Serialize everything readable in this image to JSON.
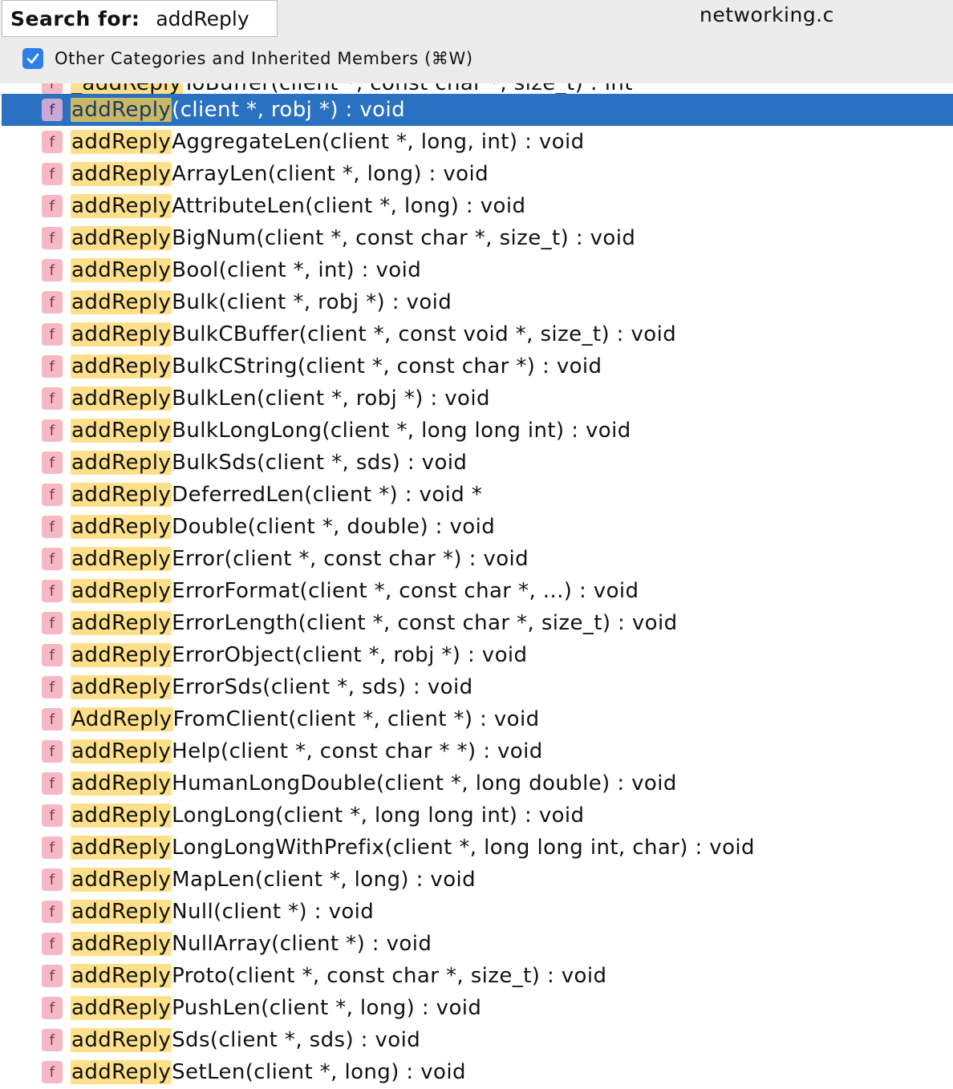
{
  "header": {
    "search_label": "Search for:",
    "search_value": "addReply",
    "file_name": "networking.c",
    "checkbox_label": "Other Categories and Inherited Members (⌘W)"
  },
  "colors": {
    "selection": "#2a72c1",
    "highlight": "#ffe08a",
    "icon_bg": "#f6b9c4",
    "checkbox": "#2f80e6"
  },
  "list": {
    "clipped_item": {
      "icon": "f",
      "match": "_addReply",
      "rest": "ToBuffer(client *, const char *, size_t) : int"
    },
    "selected_index": 0,
    "items": [
      {
        "icon": "f",
        "match": "addReply",
        "rest": "(client *, robj *) : void"
      },
      {
        "icon": "f",
        "match": "addReply",
        "rest": "AggregateLen(client *, long, int) : void"
      },
      {
        "icon": "f",
        "match": "addReply",
        "rest": "ArrayLen(client *, long) : void"
      },
      {
        "icon": "f",
        "match": "addReply",
        "rest": "AttributeLen(client *, long) : void"
      },
      {
        "icon": "f",
        "match": "addReply",
        "rest": "BigNum(client *, const char *, size_t) : void"
      },
      {
        "icon": "f",
        "match": "addReply",
        "rest": "Bool(client *, int) : void"
      },
      {
        "icon": "f",
        "match": "addReply",
        "rest": "Bulk(client *, robj *) : void"
      },
      {
        "icon": "f",
        "match": "addReply",
        "rest": "BulkCBuffer(client *, const void *, size_t) : void"
      },
      {
        "icon": "f",
        "match": "addReply",
        "rest": "BulkCString(client *, const char *) : void"
      },
      {
        "icon": "f",
        "match": "addReply",
        "rest": "BulkLen(client *, robj *) : void"
      },
      {
        "icon": "f",
        "match": "addReply",
        "rest": "BulkLongLong(client *, long long int) : void"
      },
      {
        "icon": "f",
        "match": "addReply",
        "rest": "BulkSds(client *, sds) : void"
      },
      {
        "icon": "f",
        "match": "addReply",
        "rest": "DeferredLen(client *) : void *"
      },
      {
        "icon": "f",
        "match": "addReply",
        "rest": "Double(client *, double) : void"
      },
      {
        "icon": "f",
        "match": "addReply",
        "rest": "Error(client *, const char *) : void"
      },
      {
        "icon": "f",
        "match": "addReply",
        "rest": "ErrorFormat(client *, const char *, ...) : void"
      },
      {
        "icon": "f",
        "match": "addReply",
        "rest": "ErrorLength(client *, const char *, size_t) : void"
      },
      {
        "icon": "f",
        "match": "addReply",
        "rest": "ErrorObject(client *, robj *) : void"
      },
      {
        "icon": "f",
        "match": "addReply",
        "rest": "ErrorSds(client *, sds) : void"
      },
      {
        "icon": "f",
        "match": "AddReply",
        "rest": "FromClient(client *, client *) : void"
      },
      {
        "icon": "f",
        "match": "addReply",
        "rest": "Help(client *, const char * *) : void"
      },
      {
        "icon": "f",
        "match": "addReply",
        "rest": "HumanLongDouble(client *, long double) : void"
      },
      {
        "icon": "f",
        "match": "addReply",
        "rest": "LongLong(client *, long long int) : void"
      },
      {
        "icon": "f",
        "match": "addReply",
        "rest": "LongLongWithPrefix(client *, long long int, char) : void"
      },
      {
        "icon": "f",
        "match": "addReply",
        "rest": "MapLen(client *, long) : void"
      },
      {
        "icon": "f",
        "match": "addReply",
        "rest": "Null(client *) : void"
      },
      {
        "icon": "f",
        "match": "addReply",
        "rest": "NullArray(client *) : void"
      },
      {
        "icon": "f",
        "match": "addReply",
        "rest": "Proto(client *, const char *, size_t) : void"
      },
      {
        "icon": "f",
        "match": "addReply",
        "rest": "PushLen(client *, long) : void"
      },
      {
        "icon": "f",
        "match": "addReply",
        "rest": "Sds(client *, sds) : void"
      },
      {
        "icon": "f",
        "match": "addReply",
        "rest": "SetLen(client *, long) : void"
      }
    ]
  }
}
